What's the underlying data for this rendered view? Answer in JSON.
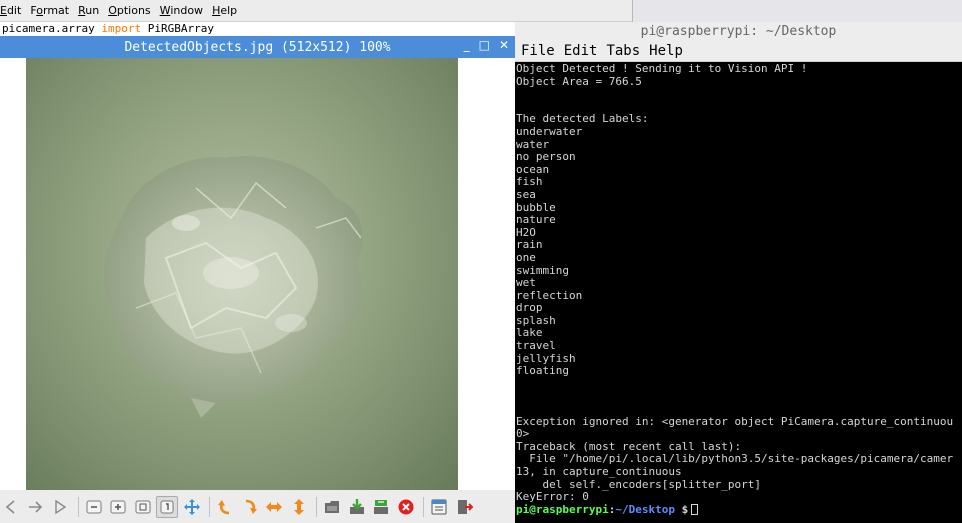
{
  "editor": {
    "menu": [
      {
        "pre": "",
        "mnem": "E",
        "post": "dit",
        "show_from": 1
      },
      {
        "pre": "F",
        "mnem": "o",
        "post": "rmat"
      },
      {
        "pre": "",
        "mnem": "R",
        "post": "un"
      },
      {
        "pre": "",
        "mnem": "O",
        "post": "ptions"
      },
      {
        "pre": "",
        "mnem": "W",
        "post": "indow"
      },
      {
        "pre": "",
        "mnem": "H",
        "post": "elp"
      }
    ],
    "code_line": {
      "module": "picamera.array ",
      "keyword": "import",
      "name": " PiRGBArray"
    }
  },
  "viewer": {
    "title": "DetectedObjects.jpg (512x512) 100%",
    "controls": {
      "minimize": "_",
      "maximize": "□",
      "close": "✕"
    },
    "toolbar": [
      "prev-icon",
      "next-icon",
      "slideshow-icon",
      "zoom-out-icon",
      "zoom-in-icon",
      "zoom-fit-icon",
      "zoom-original-icon",
      "fullscreen-icon",
      "rotate-left-icon",
      "rotate-right-icon",
      "flip-horizontal-icon",
      "flip-vertical-icon",
      "open-file-icon",
      "save-file-icon",
      "save-as-icon",
      "delete-icon",
      "preferences-icon",
      "quit-icon"
    ]
  },
  "terminal": {
    "title": "pi@raspberrypi: ~/Desktop",
    "menu": [
      "File",
      "Edit",
      "Tabs",
      "Help"
    ],
    "lines": [
      "Object Detected ! Sending it to Vision API !",
      "Object Area = 766.5",
      "",
      "",
      "The detected Labels:",
      "underwater",
      "water",
      "no person",
      "ocean",
      "fish",
      "sea",
      "bubble",
      "nature",
      "H2O",
      "rain",
      "one",
      "swimming",
      "wet",
      "reflection",
      "drop",
      "splash",
      "lake",
      "travel",
      "jellyfish",
      "floating",
      "",
      "",
      "",
      "Exception ignored in: <generator object PiCamera.capture_continuou",
      "0>",
      "Traceback (most recent call last):",
      "  File \"/home/pi/.local/lib/python3.5/site-packages/picamera/camer",
      "13, in capture_continuous",
      "    del self._encoders[splitter_port]",
      "KeyError: 0"
    ],
    "prompt": {
      "user": "pi@raspberrypi",
      "sep": ":",
      "path": "~/Desktop",
      "symbol": " $"
    }
  },
  "colors": {
    "title_blue": "#4b8dd9",
    "terminal_bg": "#000000",
    "prompt_green": "#55ff55",
    "prompt_blue": "#5c8aff",
    "keyword_orange": "#ff7700"
  }
}
